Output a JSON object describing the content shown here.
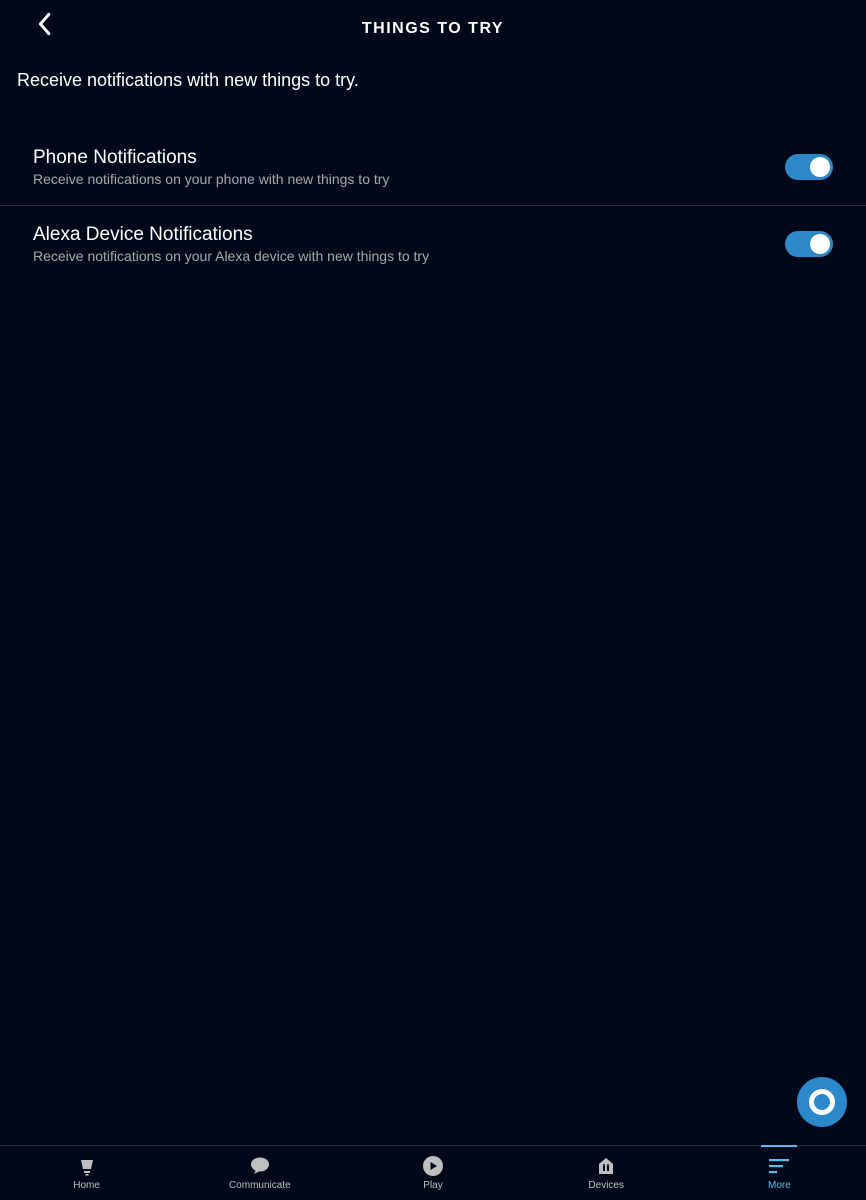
{
  "header": {
    "title": "THINGS TO TRY"
  },
  "subtitle": "Receive notifications with new things to try.",
  "settings": [
    {
      "title": "Phone Notifications",
      "desc": "Receive notifications on your phone with new things to try",
      "on": true
    },
    {
      "title": "Alexa Device Notifications",
      "desc": "Receive notifications on your Alexa device with new things to try",
      "on": true
    }
  ],
  "nav": {
    "home": "Home",
    "communicate": "Communicate",
    "play": "Play",
    "devices": "Devices",
    "more": "More"
  }
}
